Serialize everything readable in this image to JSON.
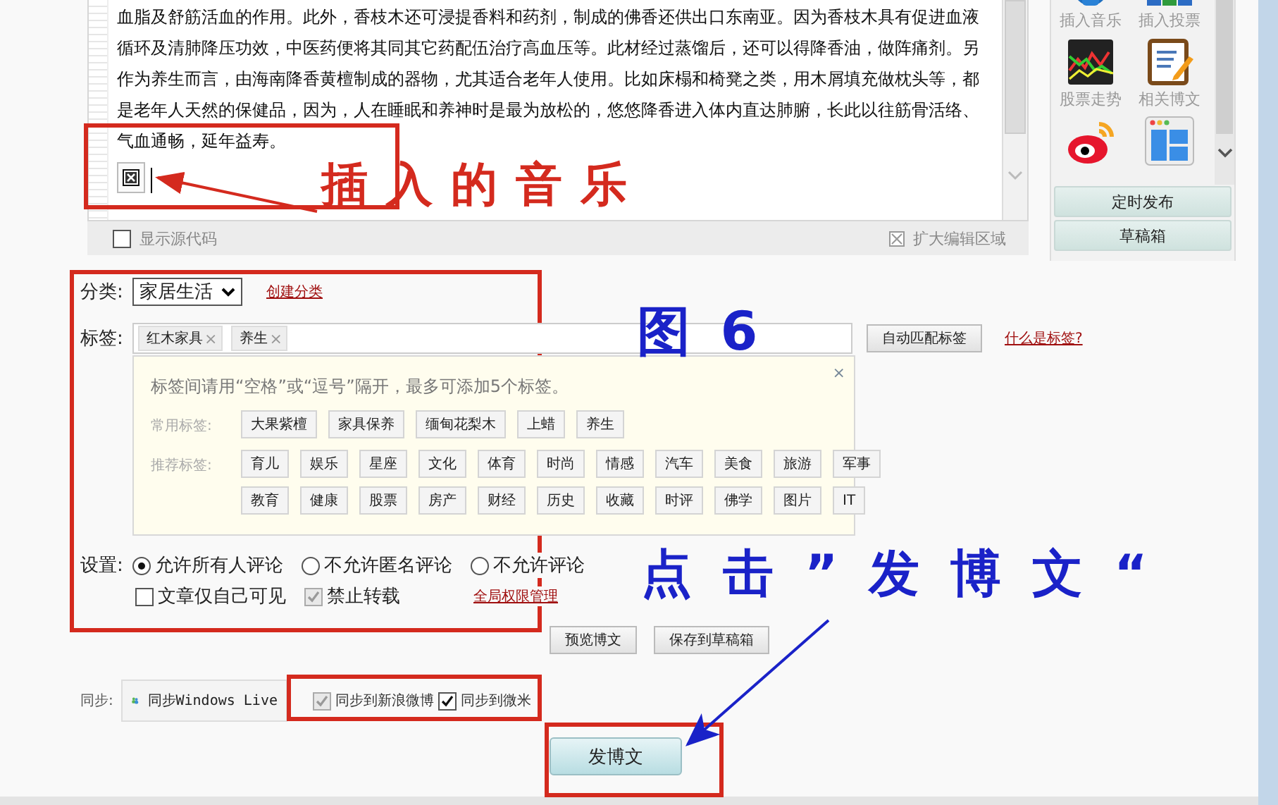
{
  "editor": {
    "lines": [
      "血脂及舒筋活血的作用。此外，香枝木还可浸提香料和药剂，制成的佛香还供出口东南亚。因为香枝木具有促进血液",
      "循环及清肺降压功效，中医药便将其同其它药配伍治疗高血压等。此材经过蒸馏后，还可以得降香油，做阵痛剂。另",
      "作为养生而言，由海南降香黄檀制成的器物，尤其适合老年人使用。比如床榻和椅凳之类，用木屑填充做枕头等，都",
      "是老年人天然的保健品，因为，人在睡眠和养神时是最为放松的，悠悠降香进入体内直达肺腑，长此以往筋骨活络、",
      "气血通畅，延年益寿。"
    ],
    "show_source": {
      "label": "显示源代码",
      "checked": false
    },
    "expand_label": "扩大编辑区域"
  },
  "sidebar": {
    "tools": [
      {
        "kind": "music",
        "label": "插入音乐"
      },
      {
        "kind": "vote",
        "label": "插入投票"
      },
      {
        "kind": "stock",
        "label": "股票走势"
      },
      {
        "kind": "posts",
        "label": "相关博文"
      },
      {
        "kind": "weibo"
      },
      {
        "kind": "template"
      }
    ],
    "buttons": [
      "定时发布",
      "草稿箱"
    ]
  },
  "category": {
    "label": "分类:",
    "value": "家居生活",
    "link": "创建分类"
  },
  "tags": {
    "label": "标签:",
    "chips": [
      {
        "text": "红木家具",
        "remove": "×"
      },
      {
        "text": "养生",
        "remove": "×"
      }
    ],
    "auto_button": "自动匹配标签",
    "help_link": "什么是标签?"
  },
  "tag_popup": {
    "hint": "标签间请用“空格”或“逗号”隔开，最多可添加5个标签。",
    "close": "×",
    "groups": [
      {
        "label": "常用标签:",
        "rows": [
          [
            "大果紫檀",
            "家具保养",
            "缅甸花梨木",
            "上蜡",
            "养生"
          ]
        ]
      },
      {
        "label": "推荐标签:",
        "rows": [
          [
            "育儿",
            "娱乐",
            "星座",
            "文化",
            "体育",
            "时尚",
            "情感",
            "汽车",
            "美食",
            "旅游",
            "军事"
          ],
          [
            "教育",
            "健康",
            "股票",
            "房产",
            "财经",
            "历史",
            "收藏",
            "时评",
            "佛学",
            "图片",
            "IT"
          ]
        ]
      }
    ]
  },
  "settings": {
    "label": "设置:",
    "comment_options": [
      {
        "label": "允许所有人评论",
        "selected": true
      },
      {
        "label": "不允许匿名评论",
        "selected": false
      },
      {
        "label": "不允许评论",
        "selected": false
      }
    ],
    "checks": [
      {
        "label": "文章仅自己可见",
        "checked": false,
        "disabled": false
      },
      {
        "label": "禁止转载",
        "checked": true,
        "disabled": true
      }
    ],
    "link": "全局权限管理"
  },
  "actions": [
    "预览博文",
    "保存到草稿箱"
  ],
  "sync": {
    "label": "同步:",
    "live_button": "同步Windows Live",
    "options": [
      {
        "label": "同步到新浪微博",
        "checked": true,
        "disabled": true
      },
      {
        "label": "同步到微米",
        "checked": true,
        "disabled": false
      }
    ]
  },
  "publish_button": "发博文",
  "annotations": [
    {
      "kind": "red",
      "text": "插入的音乐"
    },
    {
      "kind": "blue",
      "text": "图 6"
    },
    {
      "kind": "blue",
      "text": "点击”发博文“"
    }
  ]
}
